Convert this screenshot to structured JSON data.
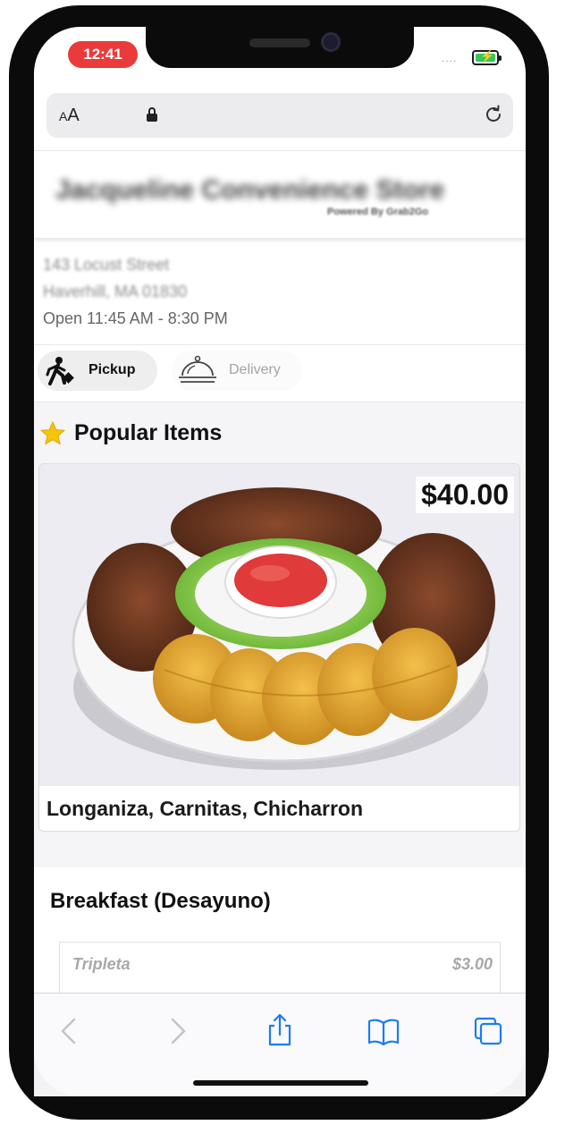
{
  "status_bar": {
    "time": "12:41",
    "signal": "....",
    "battery_charging": true
  },
  "browser": {
    "text_size_label": "AA",
    "url_hidden": true
  },
  "store": {
    "name": "Jacqueline Convenience Store",
    "powered_by": "Powered By Grab2Go",
    "address_line1": "143 Locust Street",
    "address_line2": "Haverhill, MA 01830",
    "hours": "Open 11:45 AM - 8:30 PM"
  },
  "order_mode": {
    "pickup_label": "Pickup",
    "delivery_label": "Delivery",
    "selected": "Pickup"
  },
  "popular": {
    "title": "Popular Items",
    "item": {
      "price": "$40.00",
      "name": "Longaniza, Carnitas, Chicharron"
    }
  },
  "breakfast": {
    "title": "Breakfast (Desayuno)",
    "items": [
      {
        "name": "Tripleta",
        "price": "$3.00"
      }
    ]
  },
  "toolbar": {
    "icons": [
      "back-icon",
      "forward-icon",
      "share-icon",
      "bookmarks-icon",
      "tabs-icon"
    ]
  },
  "colors": {
    "time_pill": "#ea3a3a",
    "battery": "#34c759",
    "ios_blue": "#1a7cf5",
    "star": "#f6c40c"
  }
}
